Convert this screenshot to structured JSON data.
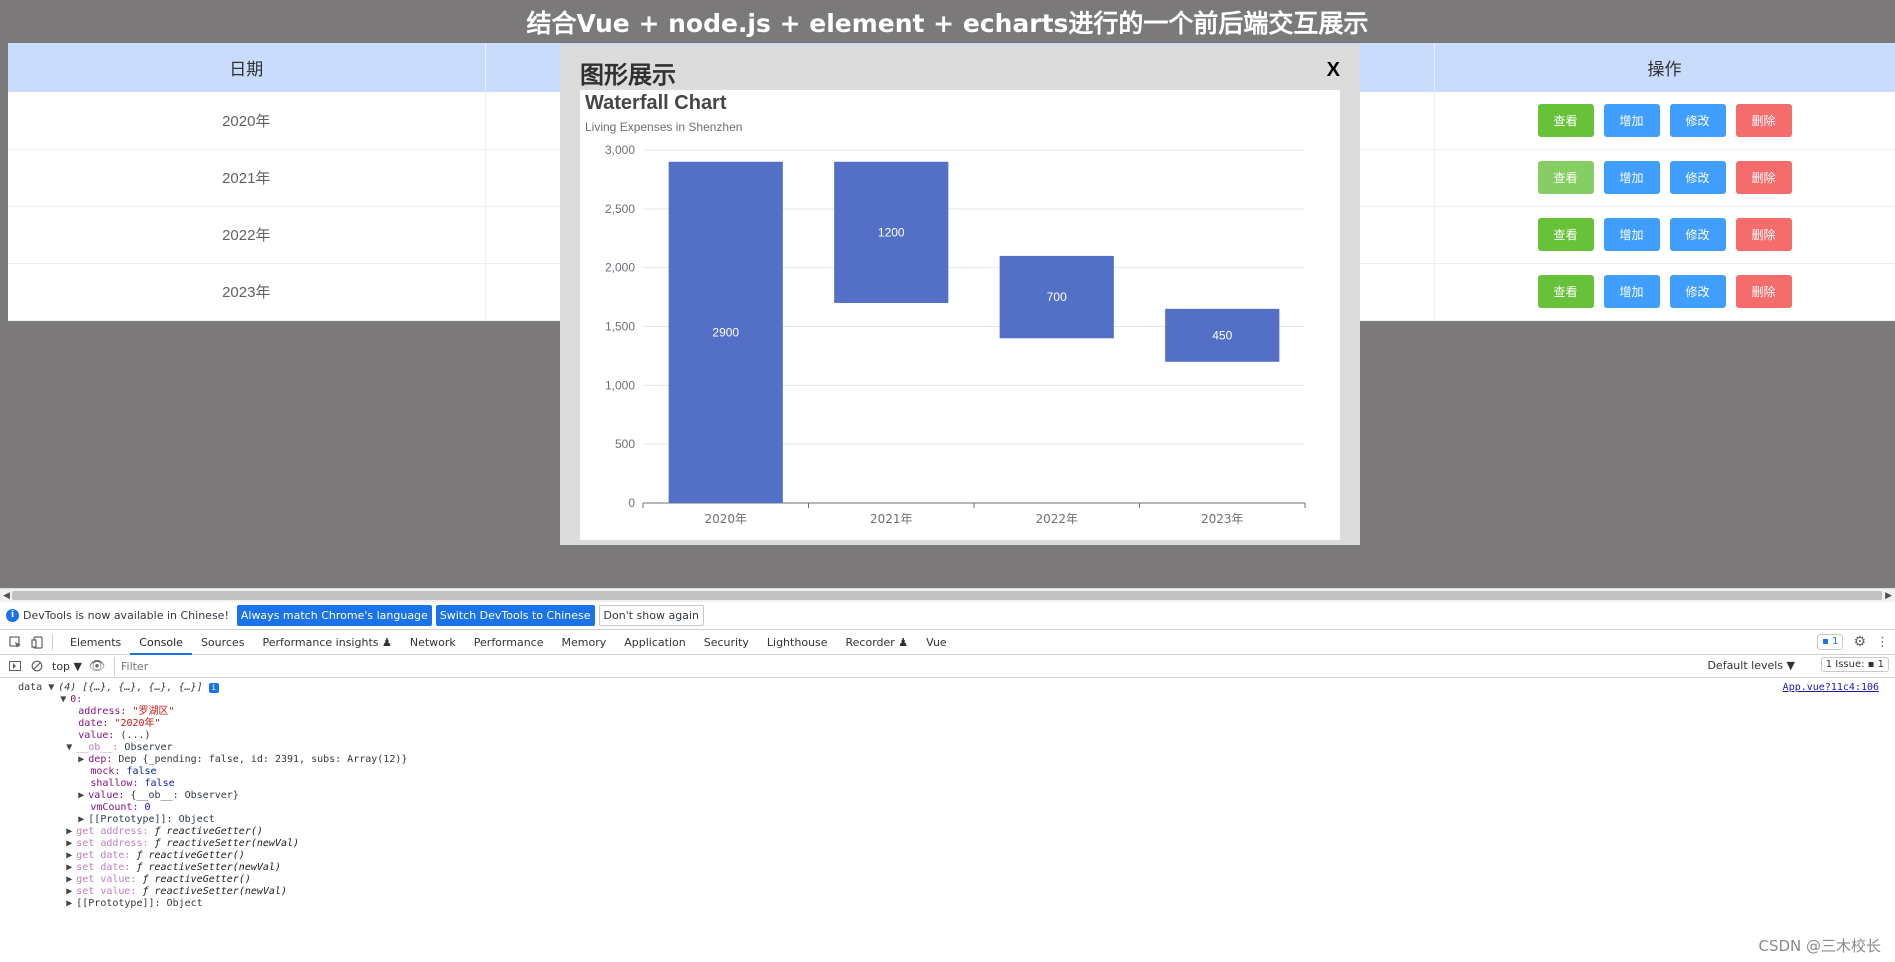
{
  "page": {
    "title": "结合Vue + node.js + element + echarts进行的一个前后端交互展示"
  },
  "table": {
    "headers": {
      "date": "日期",
      "operations": "操作"
    },
    "rows": [
      {
        "date": "2020年"
      },
      {
        "date": "2021年"
      },
      {
        "date": "2022年"
      },
      {
        "date": "2023年"
      }
    ],
    "buttons": {
      "view": "查看",
      "add": "增加",
      "edit": "修改",
      "delete": "删除"
    }
  },
  "modal": {
    "title": "图形展示",
    "close_label": "X"
  },
  "chart_data": {
    "type": "bar",
    "title": "Waterfall Chart",
    "subtitle": "Living Expenses in Shenzhen",
    "categories": [
      "2020年",
      "2021年",
      "2022年",
      "2023年"
    ],
    "series": [
      {
        "base": [
          0,
          1700,
          1400,
          1200
        ],
        "values": [
          2900,
          1200,
          700,
          450
        ],
        "labels": [
          "2900",
          "1200",
          "700",
          "450"
        ]
      }
    ],
    "ylim": [
      0,
      3000
    ],
    "yticks": [
      0,
      500,
      1000,
      1500,
      2000,
      2500,
      3000
    ],
    "ytick_labels": [
      "0",
      "500",
      "1,000",
      "1,500",
      "2,000",
      "2,500",
      "3,000"
    ],
    "grid": true,
    "bar_color": "#5470c6"
  },
  "devtools": {
    "info": {
      "text": "DevTools is now available in Chinese!",
      "match_button": "Always match Chrome's language",
      "switch_button": "Switch DevTools to Chinese",
      "dismiss_button": "Don't show again"
    },
    "tabs": [
      "Elements",
      "Console",
      "Sources",
      "Performance insights ♟",
      "Network",
      "Performance",
      "Memory",
      "Application",
      "Security",
      "Lighthouse",
      "Recorder ♟",
      "Vue"
    ],
    "active_tab": "Console",
    "messages_badge": "1",
    "context": "top ▼",
    "filter_placeholder": "Filter",
    "levels": "Default levels ▼",
    "issues": "1 Issue: ▪ 1",
    "source_link": "App.vue?11c4:106",
    "console": {
      "data_label": "data",
      "array_summary": "(4) [{…}, {…}, {…}, {…}]",
      "item_index": "0:",
      "address_key": "address:",
      "address_val": "\"罗湖区\"",
      "date_key": "date:",
      "date_val": "\"2020年\"",
      "value_key": "value:",
      "value_val": "(...)",
      "ob_key": "__ob__:",
      "ob_val": "Observer",
      "dep_key": "dep:",
      "dep_val": "Dep {_pending: false, id: 2391, subs: Array(12)}",
      "mock_key": "mock:",
      "mock_val": "false",
      "shallow_key": "shallow:",
      "shallow_val": "false",
      "vvalue_key": "value:",
      "vvalue_val": "{__ob__: Observer}",
      "vmcount_key": "vmCount:",
      "vmcount_val": "0",
      "proto1": "[[Prototype]]: Object",
      "get_address": "get address:",
      "set_address": "set address:",
      "get_date": "get date:",
      "set_date": "set date:",
      "get_value": "get value:",
      "set_value": "set value:",
      "getter_fn": "ƒ reactiveGetter()",
      "setter_fn": "ƒ reactiveSetter(newVal)",
      "proto2": "[[Prototype]]: Object"
    }
  },
  "watermark": "CSDN @三木校长"
}
